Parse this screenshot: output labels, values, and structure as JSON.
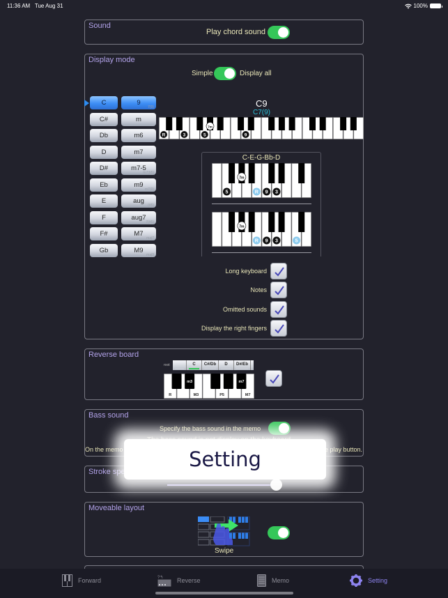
{
  "status_bar": {
    "time": "11:36 AM",
    "date": "Tue Aug 31",
    "battery": "100%"
  },
  "sound": {
    "title": "Sound",
    "play_chord_label": "Play chord sound",
    "play_chord_on": true
  },
  "display_mode": {
    "title": "Display mode",
    "simple_label": "Simple",
    "display_all_label": "Display all",
    "display_all_on": true,
    "roots": [
      "C",
      "C#",
      "Db",
      "D",
      "D#",
      "Eb",
      "E",
      "F",
      "F#",
      "Gb"
    ],
    "selected_root": "C",
    "qualities": [
      {
        "label": "9",
        "sub": "7(9)"
      },
      {
        "label": "m",
        "sub": ""
      },
      {
        "label": "m6",
        "sub": ""
      },
      {
        "label": "m7",
        "sub": ""
      },
      {
        "label": "m7-5",
        "sub": "m7(b5)"
      },
      {
        "label": "m9",
        "sub": "m7(9)"
      },
      {
        "label": "aug",
        "sub": "(#5)"
      },
      {
        "label": "aug7",
        "sub": "7(#5)"
      },
      {
        "label": "M7",
        "sub": "maj7"
      },
      {
        "label": "M9",
        "sub": "maj9"
      }
    ],
    "selected_quality": "9",
    "chord_name": "C9",
    "chord_alt_name": "C7(9)",
    "long_keyboard_marks": [
      {
        "white_index": 0,
        "label": "R"
      },
      {
        "white_index": 2,
        "label": "3"
      },
      {
        "white_index": 4,
        "label": "5"
      },
      {
        "black_after_white": 5,
        "label": "7m"
      },
      {
        "white_index": 8,
        "label": "9"
      }
    ],
    "voicing_notes": "C-E-G-Bb-D",
    "voicings": [
      {
        "marks": [
          {
            "white": 1,
            "label": "5",
            "style": "dark"
          },
          {
            "black_after": 2,
            "label": "7m",
            "style": "dark"
          },
          {
            "white": 4,
            "label": "R",
            "style": "light"
          },
          {
            "white": 5,
            "label": "9",
            "style": "dark"
          },
          {
            "white": 6,
            "label": "3",
            "style": "dark"
          }
        ]
      },
      {
        "marks": [
          {
            "black_after": 2,
            "label": "7m",
            "style": "dark"
          },
          {
            "white": 4,
            "label": "R",
            "style": "light"
          },
          {
            "white": 5,
            "label": "9",
            "style": "dark"
          },
          {
            "white": 6,
            "label": "3",
            "style": "dark"
          },
          {
            "white": 8,
            "label": "5",
            "style": "light"
          }
        ]
      }
    ],
    "options": [
      {
        "label": "Long keyboard",
        "checked": true
      },
      {
        "label": "Notes",
        "checked": true
      },
      {
        "label": "Omitted sounds",
        "checked": true
      },
      {
        "label": "Display the right fingers",
        "checked": true
      }
    ]
  },
  "reverse_board": {
    "title": "Reverse board",
    "root_label": "root",
    "root_tabs": [
      "",
      "C",
      "C#/Db",
      "D",
      "D#/Eb"
    ],
    "selected_root_tab": "C",
    "white_labels": [
      "R",
      "",
      "M3",
      "",
      "P5",
      "",
      "M7"
    ],
    "black_labels": [
      "",
      "m3",
      "",
      "",
      "m7"
    ],
    "checked": true
  },
  "bass_sound": {
    "title": "Bass sound",
    "specify_label": "Specify the bass sound in the memo",
    "specify_on": true,
    "note1": "The bass sound is not display on the keyboard",
    "note2_left": "On the memo",
    "note2_right": "e play button."
  },
  "stroke_speed": {
    "title": "Stroke spe",
    "value": 0.95
  },
  "moveable_layout": {
    "title": "Moveable layout",
    "caption": "Swipe",
    "on": true
  },
  "overlay": {
    "text": "Setting"
  },
  "tabbar": {
    "tabs": [
      {
        "label": "Forward",
        "icon": "piano-keys-icon"
      },
      {
        "label": "Reverse",
        "icon": "reverse-piano-icon"
      },
      {
        "label": "Memo",
        "icon": "memo-icon"
      },
      {
        "label": "Setting",
        "icon": "gear-icon"
      }
    ],
    "active": "Setting"
  },
  "colors": {
    "accent": "#8e84f0",
    "toggle_on": "#35c759",
    "section_title": "#b3a3ea",
    "label": "#e9e6b8",
    "chord_alt": "#2bc0d8"
  }
}
